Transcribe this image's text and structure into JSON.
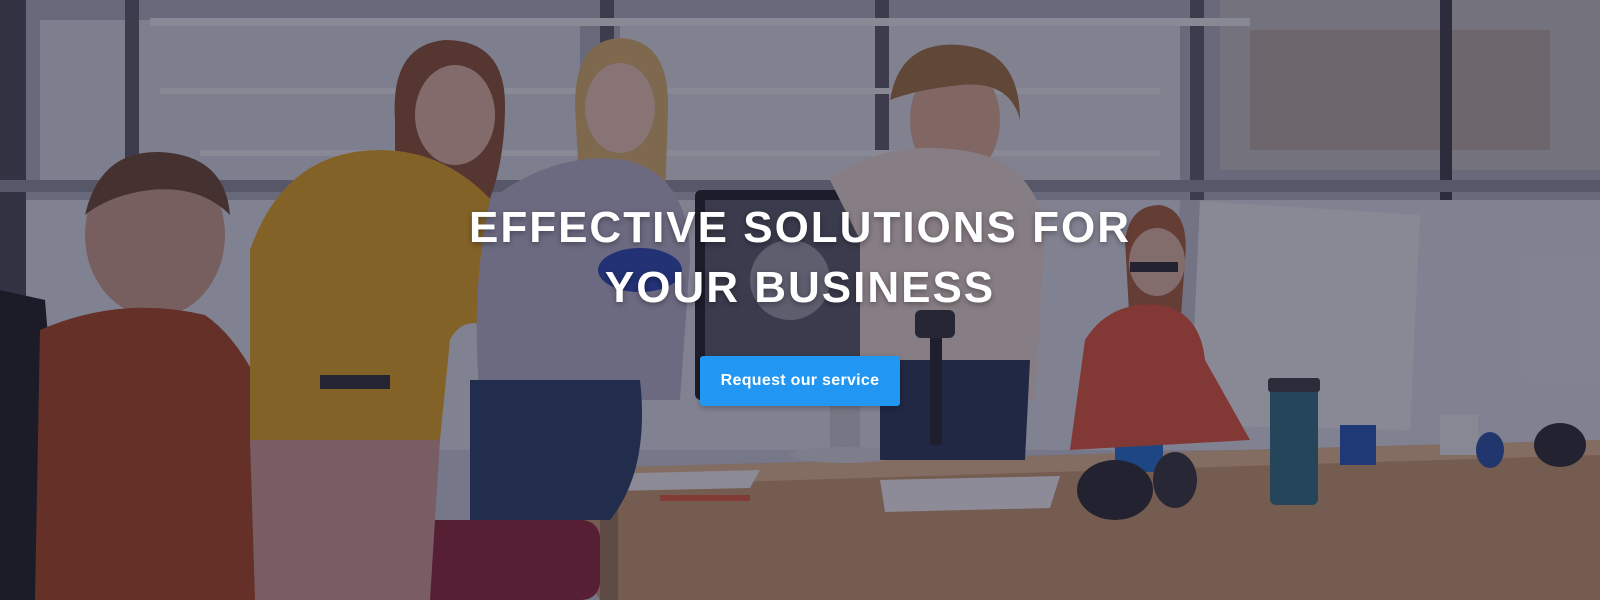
{
  "hero": {
    "headline_line1": "EFFECTIVE SOLUTIONS FOR",
    "headline_line2": "YOUR BUSINESS",
    "cta_label": "Request our service",
    "background_image": "office-team-photo"
  },
  "colors": {
    "cta_background": "#2196f3",
    "headline_text": "#ffffff",
    "overlay_tint": "#1c1a30"
  }
}
